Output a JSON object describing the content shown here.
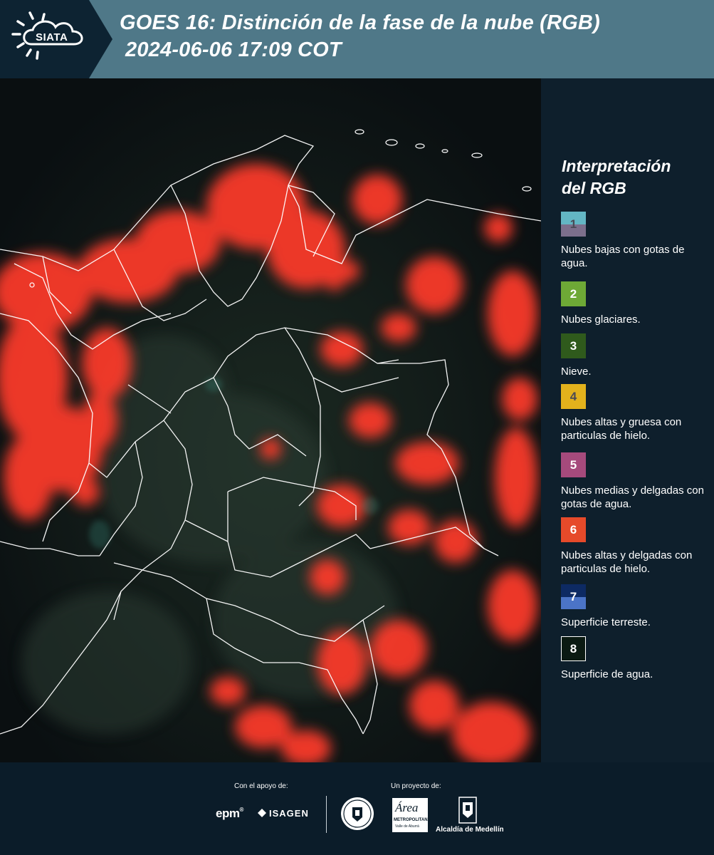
{
  "header": {
    "logo_text": "SIATA",
    "title_line1": "GOES 16: Distinción de la fase de la nube (RGB)",
    "title_line2": "2024-06-06 17:09 COT"
  },
  "legend": {
    "title_line1": "Interpretación",
    "title_line2": "del RGB",
    "items": [
      {
        "number": "1",
        "label": "Nubes bajas con gotas de agua.",
        "color_top": "#63b6c4",
        "color_bottom": "#7c6f8c",
        "num_color": "#4a4a55"
      },
      {
        "number": "2",
        "label": "Nubes glaciares.",
        "color_top": "#6ea936",
        "color_bottom": "#6ea936",
        "num_color": "#ffffff"
      },
      {
        "number": "3",
        "label": "Nieve.",
        "color_top": "#2f5a1c",
        "color_bottom": "#2f5a1c",
        "num_color": "#ffffff"
      },
      {
        "number": "4",
        "label": "Nubes altas y gruesa con particulas de hielo.",
        "color_top": "#e3b21c",
        "color_bottom": "#e3b21c",
        "num_color": "#4a4a55"
      },
      {
        "number": "5",
        "label": "Nubes medias y delgadas con gotas de agua.",
        "color_top": "#a64a7c",
        "color_bottom": "#a64a7c",
        "num_color": "#ffffff"
      },
      {
        "number": "6",
        "label": "Nubes altas y delgadas con particulas de hielo.",
        "color_top": "#e64a2a",
        "color_bottom": "#e64a2a",
        "num_color": "#ffffff"
      },
      {
        "number": "7",
        "label": "Superficie terreste.",
        "color_top": "#0d2a63",
        "color_bottom": "#4b74c7",
        "num_color": "#ffffff"
      },
      {
        "number": "8",
        "label": "Superficie de agua.",
        "color_top": "#0b1a12",
        "color_bottom": "#0b1a12",
        "num_color": "#ffffff"
      }
    ]
  },
  "footer": {
    "support_label": "Con el apoyo de:",
    "project_label": "Un proyecto de:",
    "sponsor1": "epm",
    "sponsor2": "ISAGEN",
    "partner_area_main": "Área",
    "partner_area_sub1": "METROPOLITANA",
    "partner_area_sub2": "Valle de Aburrá",
    "partner_alcaldia": "Alcaldía de Medellín"
  },
  "colors": {
    "header_bg": "#4f7888",
    "legend_bg": "#0e1f2c",
    "cloud_red": "#ff3a2a"
  }
}
